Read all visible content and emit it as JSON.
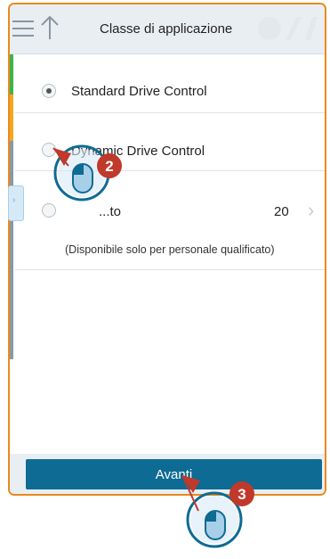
{
  "header": {
    "title": "Classe di applicazione",
    "menu_icon": "hamburger-menu-icon",
    "back_icon": "arrow-up-icon"
  },
  "options": [
    {
      "label": "Standard Drive Control",
      "selected": true
    },
    {
      "label": "Dynamic Drive Control",
      "selected": false
    },
    {
      "label": "...to",
      "value": "20",
      "selected": false,
      "note": "(Disponibile solo per personale qualificato)"
    }
  ],
  "footer": {
    "next_label": "Avanti"
  },
  "annotations": [
    {
      "step": "2",
      "icon": "mouse-click-cursor-icon"
    },
    {
      "step": "3",
      "icon": "mouse-click-cursor-icon"
    }
  ],
  "colors": {
    "frame_border": "#e98a1f",
    "accent_green": "#3cb44a",
    "accent_orange": "#f5a623",
    "button": "#0e6b93",
    "step_badge": "#c0392b"
  }
}
